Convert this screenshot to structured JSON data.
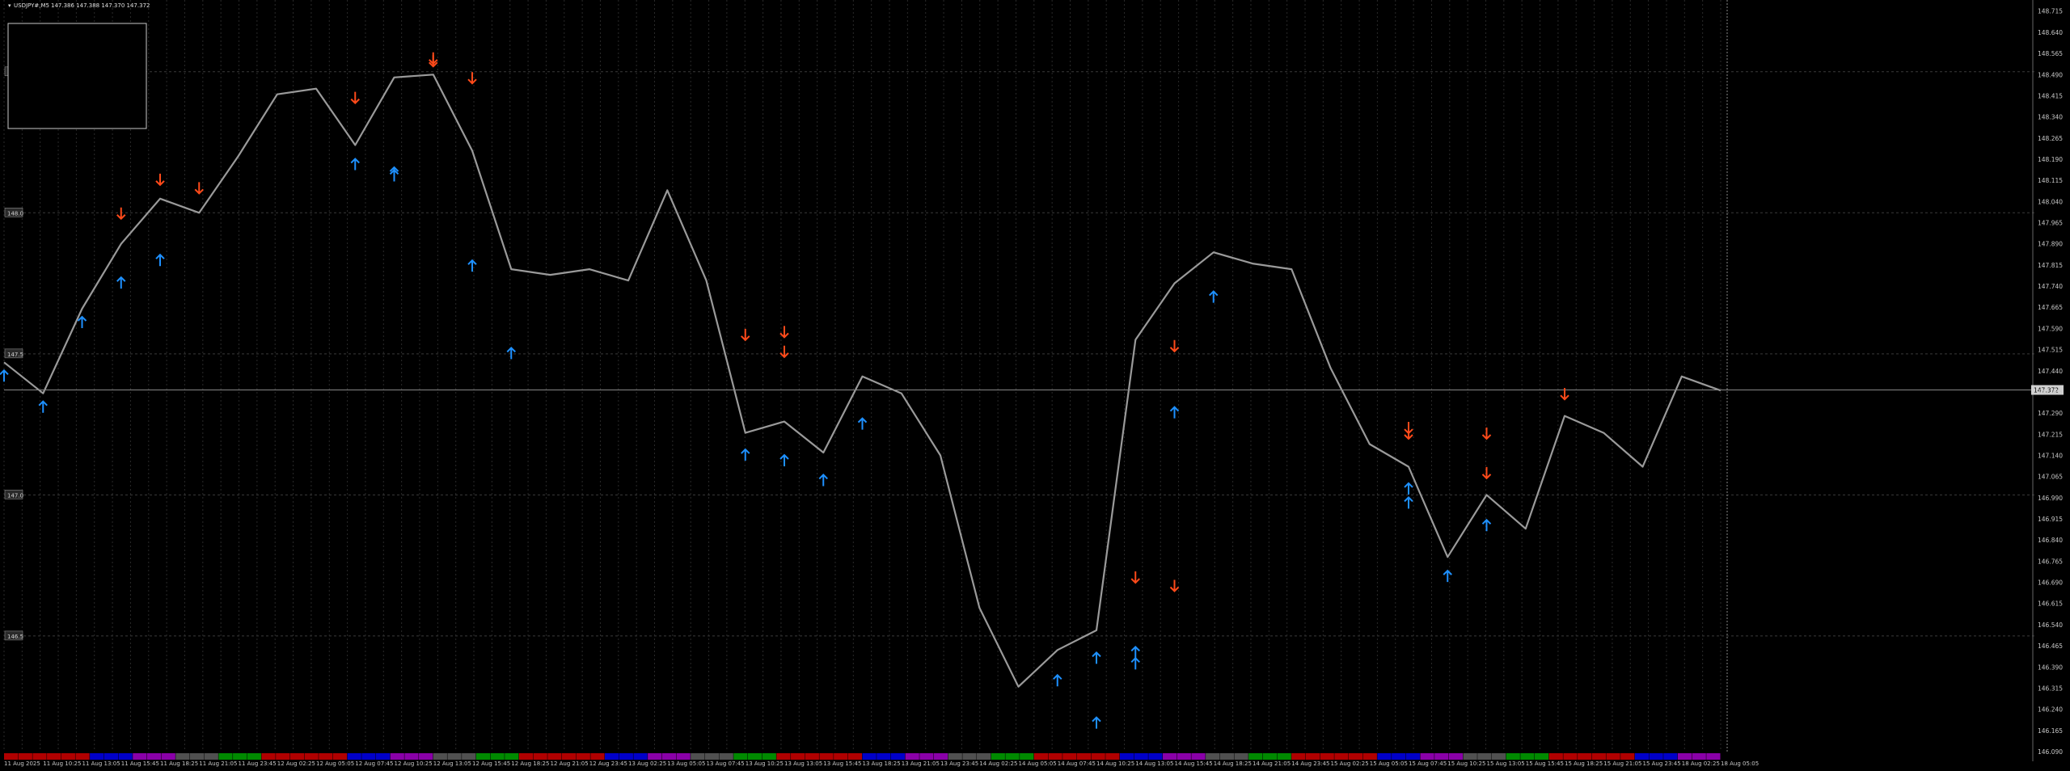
{
  "header": {
    "symbol": "USDJPY#,M5",
    "ohlc": "147.386 147.388 147.370 147.372"
  },
  "price_axis": {
    "ticks": [
      "148.715",
      "148.640",
      "148.565",
      "148.490",
      "148.415",
      "148.340",
      "148.265",
      "148.190",
      "148.115",
      "148.040",
      "147.965",
      "147.890",
      "147.815",
      "147.740",
      "147.665",
      "147.590",
      "147.515",
      "147.440",
      "147.365",
      "147.290",
      "147.215",
      "147.140",
      "147.065",
      "146.990",
      "146.915",
      "146.840",
      "146.765",
      "146.690",
      "146.615",
      "146.540",
      "146.465",
      "146.390",
      "146.315",
      "146.240",
      "146.165",
      "146.090"
    ],
    "current_price": "147.372"
  },
  "level_labels": [
    "148.5",
    "148.0",
    "147.5",
    "147.0",
    "146.5"
  ],
  "time_axis": {
    "labels": [
      "11 Aug 2025",
      "11 Aug 10:25",
      "11 Aug 13:05",
      "11 Aug 15:45",
      "11 Aug 18:25",
      "11 Aug 21:05",
      "11 Aug 23:45",
      "12 Aug 02:25",
      "12 Aug 05:05",
      "12 Aug 07:45",
      "12 Aug 10:25",
      "12 Aug 13:05",
      "12 Aug 15:45",
      "12 Aug 18:25",
      "12 Aug 21:05",
      "12 Aug 23:45",
      "13 Aug 02:25",
      "13 Aug 05:05",
      "13 Aug 07:45",
      "13 Aug 10:25",
      "13 Aug 13:05",
      "13 Aug 15:45",
      "13 Aug 18:25",
      "13 Aug 21:05",
      "13 Aug 23:45",
      "14 Aug 02:25",
      "14 Aug 05:05",
      "14 Aug 07:45",
      "14 Aug 10:25",
      "14 Aug 13:05",
      "14 Aug 15:45",
      "14 Aug 18:25",
      "14 Aug 21:05",
      "14 Aug 23:45",
      "15 Aug 02:25",
      "15 Aug 05:05",
      "15 Aug 07:45",
      "15 Aug 10:25",
      "15 Aug 13:05",
      "15 Aug 15:45",
      "15 Aug 18:25",
      "15 Aug 21:05",
      "15 Aug 23:45",
      "18 Aug 02:25",
      "18 Aug 05:05"
    ]
  },
  "colors": {
    "background": "#000000",
    "grid": "#3a3a3a",
    "price_line": "#9a9a9a",
    "up_arrow": "#1e90ff",
    "down_arrow": "#ff4a1a",
    "axis_text": "#c8c8c8",
    "session_red": "#b00000",
    "session_blue": "#0000c8",
    "session_purple": "#8a00a8",
    "session_gray": "#505050",
    "session_green": "#008a00"
  },
  "chart_data": {
    "type": "line",
    "title": "USDJPY#,M5",
    "ylim": [
      146.09,
      148.74
    ],
    "grid": true,
    "x": [
      "11 Aug 2025",
      "11 Aug 10:25",
      "11 Aug 13:05",
      "11 Aug 15:45",
      "11 Aug 18:25",
      "11 Aug 21:05",
      "11 Aug 23:45",
      "12 Aug 02:25",
      "12 Aug 05:05",
      "12 Aug 07:45",
      "12 Aug 10:25",
      "12 Aug 13:05",
      "12 Aug 15:45",
      "12 Aug 18:25",
      "12 Aug 21:05",
      "12 Aug 23:45",
      "13 Aug 02:25",
      "13 Aug 05:05",
      "13 Aug 07:45",
      "13 Aug 10:25",
      "13 Aug 13:05",
      "13 Aug 15:45",
      "13 Aug 18:25",
      "13 Aug 21:05",
      "13 Aug 23:45",
      "14 Aug 02:25",
      "14 Aug 05:05",
      "14 Aug 07:45",
      "14 Aug 10:25",
      "14 Aug 13:05",
      "14 Aug 15:45",
      "14 Aug 18:25",
      "14 Aug 21:05",
      "14 Aug 23:45",
      "15 Aug 02:25",
      "15 Aug 05:05",
      "15 Aug 07:45",
      "15 Aug 10:25",
      "15 Aug 13:05",
      "15 Aug 15:45",
      "15 Aug 18:25",
      "15 Aug 21:05",
      "15 Aug 23:45",
      "18 Aug 02:25",
      "18 Aug 05:05"
    ],
    "series": [
      {
        "values": [
          147.47,
          147.36,
          147.66,
          147.89,
          148.05,
          148.0,
          148.2,
          148.42,
          148.44,
          148.24,
          148.48,
          148.49,
          148.22,
          147.8,
          147.78,
          147.8,
          147.76,
          148.08,
          147.76,
          147.22,
          147.26,
          147.15,
          147.42,
          147.36,
          147.14,
          146.6,
          146.32,
          146.45,
          146.52,
          147.55,
          147.75,
          147.86,
          147.82,
          147.8,
          147.45,
          147.18,
          147.1,
          146.78,
          147.0,
          146.88,
          147.28,
          147.22,
          147.1,
          147.42,
          147.37
        ]
      }
    ],
    "signals_buy": [
      {
        "x": "11 Aug 2025",
        "y": 147.47
      },
      {
        "x": "11 Aug 10:25",
        "y": 147.36
      },
      {
        "x": "11 Aug 13:05",
        "y": 147.66
      },
      {
        "x": "11 Aug 15:45",
        "y": 147.8
      },
      {
        "x": "11 Aug 18:25",
        "y": 147.88
      },
      {
        "x": "12 Aug 07:45",
        "y": 148.22
      },
      {
        "x": "12 Aug 10:25",
        "y": 148.18
      },
      {
        "x": "12 Aug 10:25",
        "y": 148.19
      },
      {
        "x": "12 Aug 15:45",
        "y": 147.86
      },
      {
        "x": "12 Aug 18:25",
        "y": 147.55
      },
      {
        "x": "13 Aug 10:25",
        "y": 147.19
      },
      {
        "x": "13 Aug 13:05",
        "y": 147.17
      },
      {
        "x": "13 Aug 15:45",
        "y": 147.1
      },
      {
        "x": "13 Aug 18:25",
        "y": 147.3
      },
      {
        "x": "14 Aug 07:45",
        "y": 146.39
      },
      {
        "x": "14 Aug 10:25",
        "y": 146.24
      },
      {
        "x": "14 Aug 10:25",
        "y": 146.47
      },
      {
        "x": "14 Aug 13:05",
        "y": 146.49
      },
      {
        "x": "14 Aug 13:05",
        "y": 146.45
      },
      {
        "x": "14 Aug 15:45",
        "y": 147.34
      },
      {
        "x": "14 Aug 18:25",
        "y": 147.75
      },
      {
        "x": "15 Aug 07:45",
        "y": 147.07
      },
      {
        "x": "15 Aug 07:45",
        "y": 147.02
      },
      {
        "x": "15 Aug 10:25",
        "y": 146.76
      },
      {
        "x": "15 Aug 13:05",
        "y": 146.94
      }
    ],
    "signals_sell": [
      {
        "x": "11 Aug 15:45",
        "y": 147.95
      },
      {
        "x": "11 Aug 18:25",
        "y": 148.07
      },
      {
        "x": "11 Aug 21:05",
        "y": 148.04
      },
      {
        "x": "12 Aug 07:45",
        "y": 148.36
      },
      {
        "x": "12 Aug 13:05",
        "y": 148.5
      },
      {
        "x": "12 Aug 13:05",
        "y": 148.49
      },
      {
        "x": "12 Aug 15:45",
        "y": 148.43
      },
      {
        "x": "13 Aug 10:25",
        "y": 147.52
      },
      {
        "x": "13 Aug 13:05",
        "y": 147.53
      },
      {
        "x": "13 Aug 13:05",
        "y": 147.46
      },
      {
        "x": "14 Aug 13:05",
        "y": 146.66
      },
      {
        "x": "14 Aug 15:45",
        "y": 146.63
      },
      {
        "x": "14 Aug 15:45",
        "y": 147.48
      },
      {
        "x": "15 Aug 07:45",
        "y": 147.17
      },
      {
        "x": "15 Aug 07:45",
        "y": 147.19
      },
      {
        "x": "15 Aug 13:05",
        "y": 147.03
      },
      {
        "x": "15 Aug 13:05",
        "y": 147.17
      },
      {
        "x": "15 Aug 18:25",
        "y": 147.31
      }
    ]
  }
}
